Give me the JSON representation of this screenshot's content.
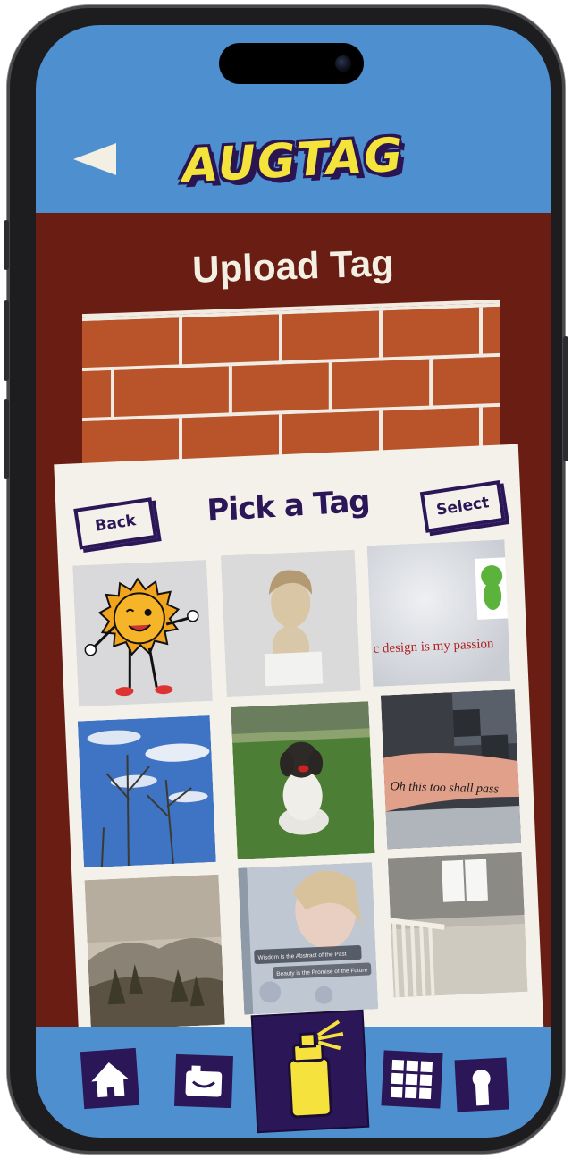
{
  "app": {
    "title": "AUGTAG"
  },
  "header": {
    "back_icon": "back-arrow-icon"
  },
  "page": {
    "title": "Upload Tag"
  },
  "picker": {
    "title": "Pick a Tag",
    "back_label": "Back",
    "select_label": "Select",
    "tiles": [
      {
        "name": "sun-cartoon",
        "caption": ""
      },
      {
        "name": "greek-bust",
        "caption": ""
      },
      {
        "name": "design-passion",
        "caption": "c design is my passion"
      },
      {
        "name": "trees-sky",
        "caption": ""
      },
      {
        "name": "dog-lawn",
        "caption": ""
      },
      {
        "name": "tattoo-arm",
        "caption": "Oh this too shall pass"
      },
      {
        "name": "watercolor-landscape",
        "caption": ""
      },
      {
        "name": "woman-poster",
        "caption_1": "Wisdom is the Abstract of the Past",
        "caption_2": "Beauty is the Promise of the Future"
      },
      {
        "name": "porch-deck",
        "caption": ""
      }
    ]
  },
  "nav": {
    "items": [
      "home-icon",
      "camera-icon",
      "spray-can-icon",
      "gallery-grid-icon",
      "profile-icon"
    ]
  },
  "colors": {
    "header_blue": "#4e8fd0",
    "background_red": "#6a1d12",
    "panel": "#f3f1e9",
    "ink_purple": "#2b1657",
    "logo_yellow": "#f3e33b",
    "spray_yellow": "#f5e23c"
  }
}
